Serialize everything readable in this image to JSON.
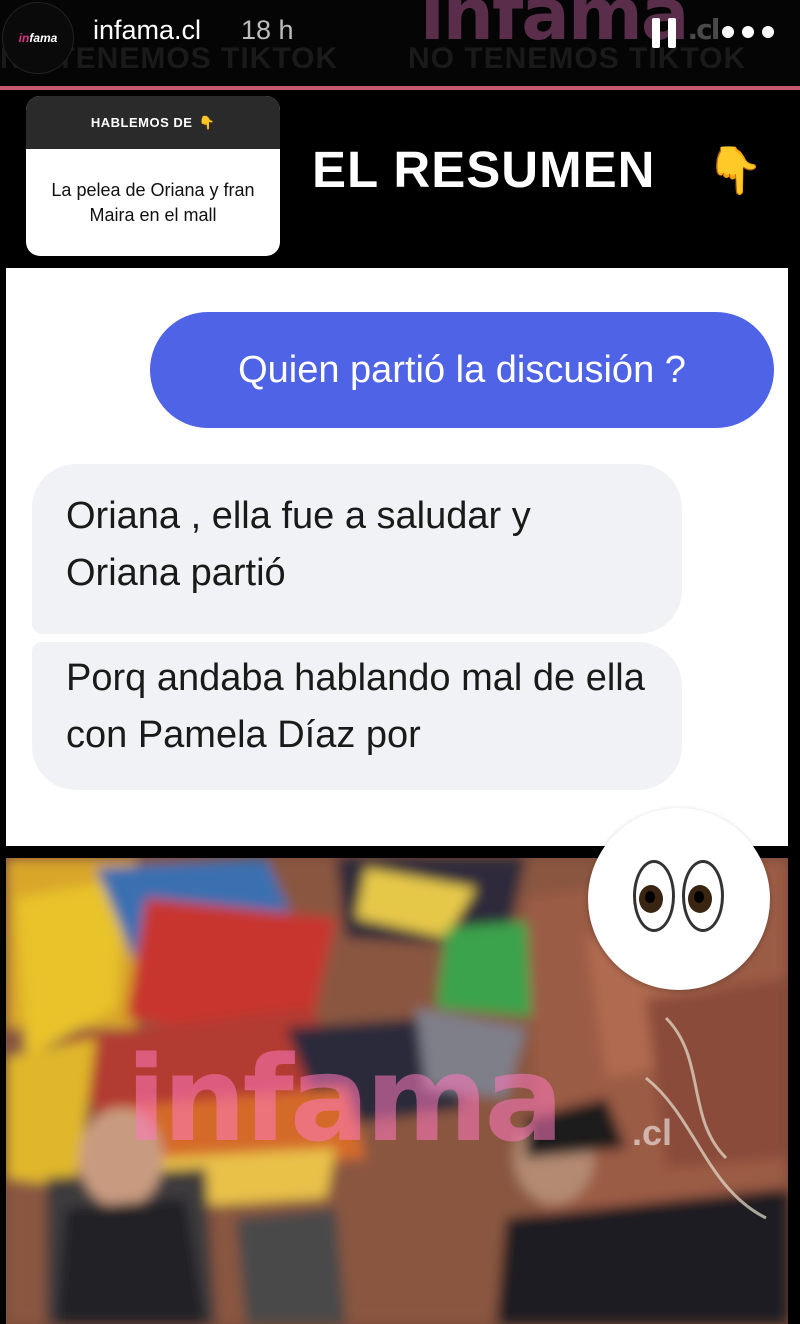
{
  "header": {
    "avatar_text_a": "in",
    "avatar_text_b": "fama",
    "account_name": "infama.cl",
    "timestamp": "18 h",
    "watermark_brand": "infama",
    "watermark_domain": ".cl",
    "tiktok_notice": "NO TENEMOS TIKTOK"
  },
  "question_sticker": {
    "label": "HABLEMOS DE",
    "label_emoji": "👇",
    "text": "La pelea de Oriana y fran Maira en el mall"
  },
  "headline": {
    "text": "EL RESUMEN",
    "emoji": "👇"
  },
  "chat": {
    "outgoing": "Quien partió la discusión ?",
    "incoming": [
      "Oriana , ella fue a saludar y Oriana partió",
      "Porq andaba hablando mal de ella con Pamela Díaz por"
    ]
  },
  "photo": {
    "watermark_brand": "infama",
    "watermark_domain": ".cl"
  },
  "eyes_sticker": {
    "icon": "eyes-emoji-icon"
  }
}
